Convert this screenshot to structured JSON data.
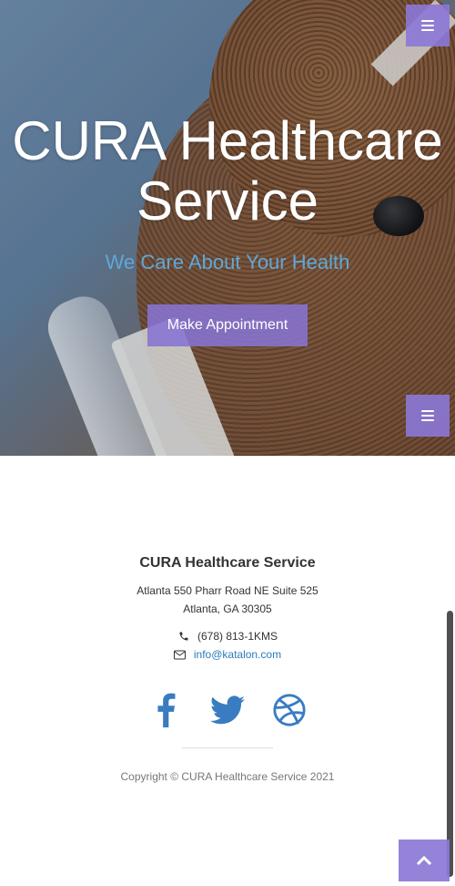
{
  "hero": {
    "title": "CURA Healthcare Service",
    "subtitle": "We Care About Your Health",
    "cta_label": "Make Appointment"
  },
  "nav": {
    "menu_icon": "bars-icon"
  },
  "footer": {
    "title": "CURA Healthcare Service",
    "address_line1": "Atlanta 550 Pharr Road NE Suite 525",
    "address_line2": "Atlanta, GA 30305",
    "phone": "(678) 813-1KMS",
    "email": "info@katalon.com",
    "socials": [
      {
        "name": "facebook",
        "icon": "facebook-icon"
      },
      {
        "name": "twitter",
        "icon": "twitter-icon"
      },
      {
        "name": "dribbble",
        "icon": "dribbble-icon"
      }
    ],
    "copyright": "Copyright © CURA Healthcare Service 2021"
  },
  "colors": {
    "accent": "#8c78d7",
    "social": "#3a7cc0",
    "subtitle": "#5fa8d8",
    "link": "#2b7bb9"
  },
  "scroll_top_icon": "chevron-up-icon"
}
